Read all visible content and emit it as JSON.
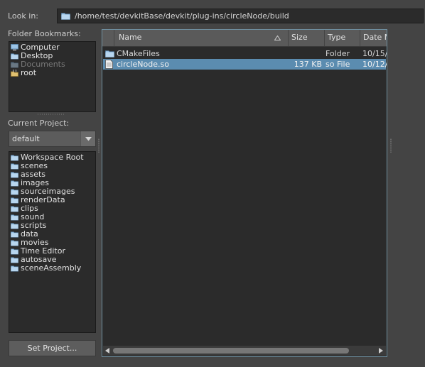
{
  "look_in": {
    "label": "Look in:",
    "path": "/home/test/devkitBase/devkit/plug-ins/circleNode/build"
  },
  "bookmarks": {
    "label": "Folder Bookmarks:",
    "items": [
      {
        "label": "Computer",
        "icon": "computer-icon"
      },
      {
        "label": "Desktop",
        "icon": "folder-icon"
      },
      {
        "label": "Documents",
        "icon": "folder-icon"
      },
      {
        "label": "root",
        "icon": "home-folder-icon"
      }
    ]
  },
  "project": {
    "label": "Current Project:",
    "selected": "default",
    "items": [
      "Workspace Root",
      "scenes",
      "assets",
      "images",
      "sourceimages",
      "renderData",
      "clips",
      "sound",
      "scripts",
      "data",
      "movies",
      "Time Editor",
      "autosave",
      "sceneAssembly"
    ]
  },
  "set_project_label": "Set Project...",
  "file_list": {
    "columns": [
      "Name",
      "Size",
      "Type",
      "Date Mo"
    ],
    "rows": [
      {
        "name": "CMakeFiles",
        "size": "",
        "type": "Folder",
        "date": "10/15/...",
        "icon": "folder-icon",
        "selected": false
      },
      {
        "name": "circleNode.so",
        "size": "137 KB",
        "type": "so File",
        "date": "10/12/...",
        "icon": "file-icon",
        "selected": true
      }
    ]
  },
  "colors": {
    "background": "#444444",
    "panel": "#2b2b2b",
    "selection": "#5b8cb0",
    "folder": "#9cc4e6"
  }
}
